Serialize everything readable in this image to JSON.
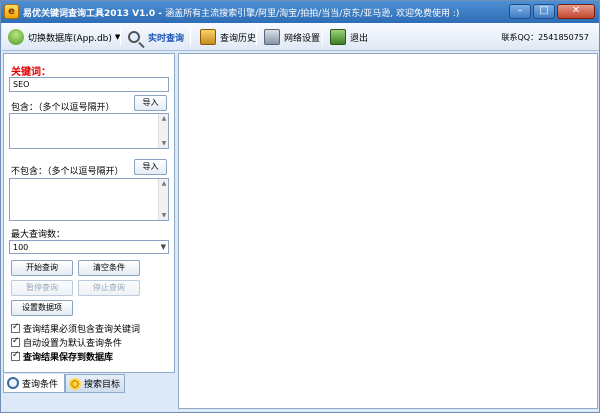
{
  "window": {
    "title": "易优关键词查询工具2013 V1.0 - ",
    "subtitle": "涵盖所有主流搜索引擎/阿里/淘宝/拍拍/当当/京东/亚马逊, 欢迎免费使用 :)",
    "minimize": "–",
    "maximize": "□",
    "close": "✕"
  },
  "toolbar": {
    "switch_db": "切换数据库(App.db)",
    "realtime": "实时查询",
    "history": "查询历史",
    "network": "网络设置",
    "exit": "退出",
    "contact": "联系QQ：2541850757"
  },
  "form": {
    "keyword_label": "关键词：",
    "keyword_value": "SEO",
    "include_label": "包含：（多个以逗号隔开）",
    "include_import": "导入",
    "exclude_label": "不包含：（多个以逗号隔开）",
    "exclude_import": "导入",
    "max_label": "最大查询数：",
    "max_value": "100",
    "btn_start": "开始查询",
    "btn_clear": "清空条件",
    "btn_pause": "暂停查询",
    "btn_stop": "停止查询",
    "btn_dataset": "设置数据项",
    "chk_must_include": "查询结果必须包含查询关键词",
    "chk_default": "自动设置为默认查询条件",
    "chk_save": "查询结果保存到数据库"
  },
  "tabs": {
    "conditions": "查询条件",
    "targets": "搜索目标"
  }
}
